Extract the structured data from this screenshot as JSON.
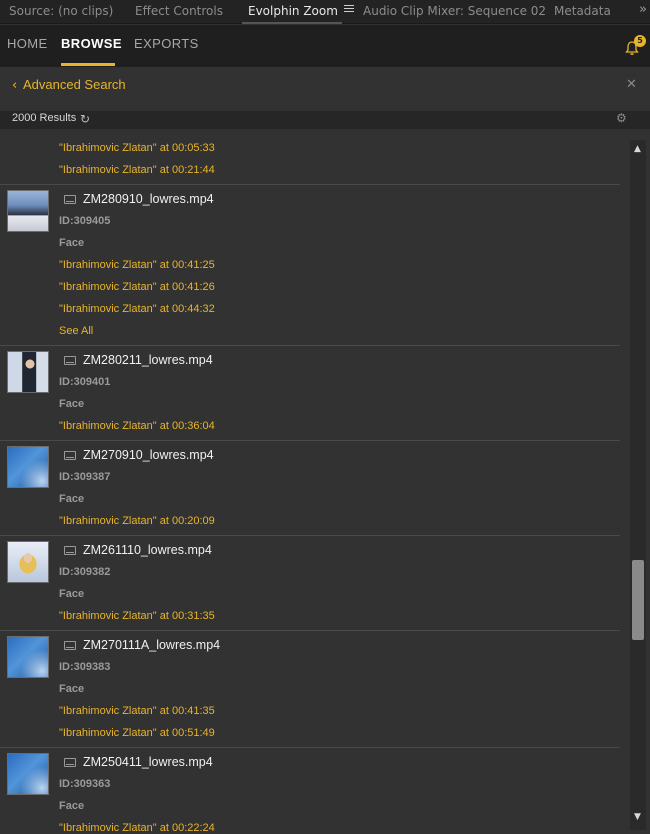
{
  "panel_tabs": {
    "source": "Source: (no clips)",
    "effect_controls": "Effect Controls",
    "evolphin_zoom": "Evolphin Zoom",
    "audio_mixer": "Audio Clip Mixer: Sequence 02",
    "metadata": "Metadata",
    "overflow": "»"
  },
  "nav": {
    "home": "HOME",
    "browse": "BROWSE",
    "exports": "EXPORTS",
    "notification_count": "5",
    "accent_color": "#e8b42a"
  },
  "advanced_search": {
    "title": "Advanced Search",
    "back_icon": "chevron-left-icon",
    "close_icon": "close-icon"
  },
  "results": {
    "count_label": "2000 Results",
    "refresh_icon": "refresh-icon",
    "settings_icon": "gear-icon"
  },
  "items": [
    {
      "filename": "",
      "id": "",
      "type": "",
      "hits": [
        "\"Ibrahimovic Zlatan\" at 00:05:33",
        "\"Ibrahimovic Zlatan\" at 00:21:44"
      ],
      "see_all": ""
    },
    {
      "filename": "ZM280910_lowres.mp4",
      "id": "ID:309405",
      "type": "Face",
      "hits": [
        "\"Ibrahimovic Zlatan\" at 00:41:25",
        "\"Ibrahimovic Zlatan\" at 00:41:26",
        "\"Ibrahimovic Zlatan\" at 00:44:32"
      ],
      "see_all": "See All"
    },
    {
      "filename": "ZM280211_lowres.mp4",
      "id": "ID:309401",
      "type": "Face",
      "hits": [
        "\"Ibrahimovic Zlatan\" at 00:36:04"
      ],
      "see_all": ""
    },
    {
      "filename": "ZM270910_lowres.mp4",
      "id": "ID:309387",
      "type": "Face",
      "hits": [
        "\"Ibrahimovic Zlatan\" at 00:20:09"
      ],
      "see_all": ""
    },
    {
      "filename": "ZM261110_lowres.mp4",
      "id": "ID:309382",
      "type": "Face",
      "hits": [
        "\"Ibrahimovic Zlatan\" at 00:31:35"
      ],
      "see_all": ""
    },
    {
      "filename": "ZM270111A_lowres.mp4",
      "id": "ID:309383",
      "type": "Face",
      "hits": [
        "\"Ibrahimovic Zlatan\" at 00:41:35",
        "\"Ibrahimovic Zlatan\" at 00:51:49"
      ],
      "see_all": ""
    },
    {
      "filename": "ZM250411_lowres.mp4",
      "id": "ID:309363",
      "type": "Face",
      "hits": [
        "\"Ibrahimovic Zlatan\" at 00:22:24"
      ],
      "see_all": ""
    }
  ]
}
